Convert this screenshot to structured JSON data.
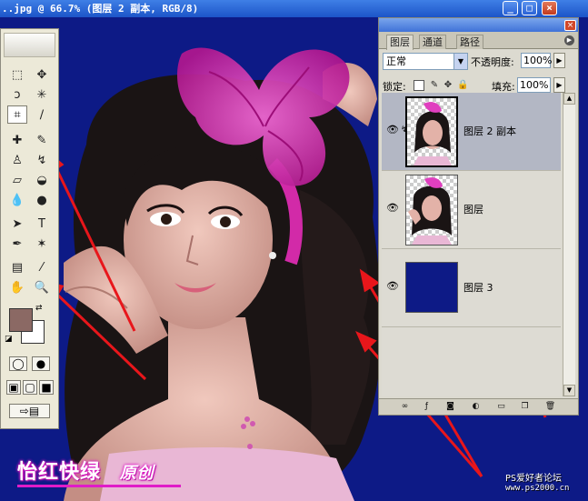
{
  "window": {
    "title": "..jpg @ 66.7% (图层 2 副本, RGB/8)",
    "min_label": "_",
    "max_label": "□",
    "close_label": "×"
  },
  "photo": {
    "description_colors": {
      "background": "#0d1a86",
      "bow": "#e03fbf",
      "hair": "#1b1515",
      "skin": "#d8a9a0"
    }
  },
  "toolbox": {
    "foreground_color": "#8b6964",
    "background_color": "#ffffff",
    "tools": [
      {
        "name": "marquee-icon",
        "glyph": "⬚"
      },
      {
        "name": "move-icon",
        "glyph": "✥"
      },
      {
        "name": "lasso-icon",
        "glyph": "ↄ"
      },
      {
        "name": "magic-wand-icon",
        "glyph": "✳"
      },
      {
        "name": "crop-icon",
        "glyph": "⌗"
      },
      {
        "name": "slice-icon",
        "glyph": "∕"
      },
      {
        "name": "healing-brush-icon",
        "glyph": "✚"
      },
      {
        "name": "brush-icon",
        "glyph": "✎"
      },
      {
        "name": "clone-stamp-icon",
        "glyph": "♙"
      },
      {
        "name": "history-brush-icon",
        "glyph": "↯"
      },
      {
        "name": "eraser-icon",
        "glyph": "▱"
      },
      {
        "name": "paint-bucket-icon",
        "glyph": "◒"
      },
      {
        "name": "blur-icon",
        "glyph": "💧"
      },
      {
        "name": "dodge-icon",
        "glyph": "●"
      },
      {
        "name": "path-select-icon",
        "glyph": "➤"
      },
      {
        "name": "type-icon",
        "glyph": "T"
      },
      {
        "name": "pen-icon",
        "glyph": "✒"
      },
      {
        "name": "shape-icon",
        "glyph": "✶"
      },
      {
        "name": "notes-icon",
        "glyph": "▤"
      },
      {
        "name": "eyedropper-icon",
        "glyph": "⁄"
      },
      {
        "name": "hand-icon",
        "glyph": "✋"
      },
      {
        "name": "zoom-icon",
        "glyph": "🔍"
      }
    ]
  },
  "layers_panel": {
    "tabs": [
      "图层",
      "通道",
      "路径"
    ],
    "active_tab": "图层",
    "blend_mode": "正常",
    "opacity_label": "不透明度:",
    "opacity_value": "100%",
    "lock_label": "锁定:",
    "fill_label": "填充:",
    "fill_value": "100%",
    "layers": [
      {
        "name": "图层 2 副本",
        "visible": true,
        "active": true,
        "linked": true
      },
      {
        "name": "图层",
        "visible": true,
        "active": false,
        "linked": false
      },
      {
        "name": "图层 3",
        "visible": true,
        "active": false,
        "linked": false
      }
    ]
  },
  "overlay": {
    "signature": "怡红快绿",
    "signature_suffix": "原创",
    "watermark_line1": "PS爱好者论坛",
    "watermark_line2": "www.ps2000.cn"
  }
}
